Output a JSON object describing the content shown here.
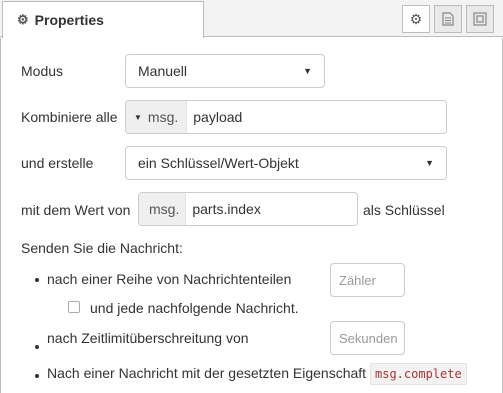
{
  "tabs": {
    "active_label": "Properties",
    "icons": [
      "gear-icon",
      "document-icon",
      "frame-icon"
    ]
  },
  "form": {
    "modus_label": "Modus",
    "modus_value": "Manuell",
    "combine_label": "Kombiniere alle",
    "combine_prefix": "msg.",
    "combine_value": "payload",
    "create_label": "und erstelle",
    "create_value": "ein Schlüssel/Wert-Objekt",
    "key_label": "mit dem Wert von",
    "key_prefix": "msg.",
    "key_value": "parts.index",
    "key_suffix": "als Schlüssel",
    "send_heading": "Senden Sie die Nachricht:",
    "send_parts_label": "nach einer Reihe von Nachrichtenteilen",
    "count_placeholder": "Zähler",
    "each_following_label": "und jede nachfolgende Nachricht.",
    "each_following_checked": false,
    "timeout_label": "nach Zeitlimitüberschreitung von",
    "seconds_placeholder": "Sekunden",
    "complete_label": "Nach einer Nachricht mit der gesetzten Eigenschaft",
    "complete_code": "msg.complete"
  }
}
